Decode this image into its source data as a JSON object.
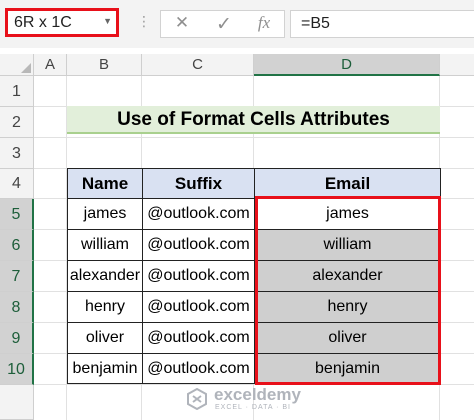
{
  "formula_bar": {
    "name_box": "6R x 1C",
    "cancel_icon": "✕",
    "enter_icon": "✓",
    "function_icon": "fx",
    "formula": "=B5"
  },
  "columns": [
    "A",
    "B",
    "C",
    "D"
  ],
  "rows": [
    "1",
    "2",
    "3",
    "4",
    "5",
    "6",
    "7",
    "8",
    "9",
    "10"
  ],
  "title": "Use of Format Cells Attributes",
  "table": {
    "headers": [
      "Name",
      "Suffix",
      "Email"
    ],
    "rows": [
      [
        "james",
        "@outlook.com",
        "james"
      ],
      [
        "william",
        "@outlook.com",
        "william"
      ],
      [
        "alexander",
        "@outlook.com",
        "alexander"
      ],
      [
        "henry",
        "@outlook.com",
        "henry"
      ],
      [
        "oliver",
        "@outlook.com",
        "oliver"
      ],
      [
        "benjamin",
        "@outlook.com",
        "benjamin"
      ]
    ]
  },
  "watermark": {
    "name": "exceldemy",
    "tagline": "EXCEL · DATA · BI"
  },
  "colors": {
    "selection_outline": "#e8101a",
    "title_fill": "#e2efda",
    "header_fill": "#d9e1f2",
    "selected_fill": "#cfcfcf",
    "excel_green": "#217346"
  }
}
